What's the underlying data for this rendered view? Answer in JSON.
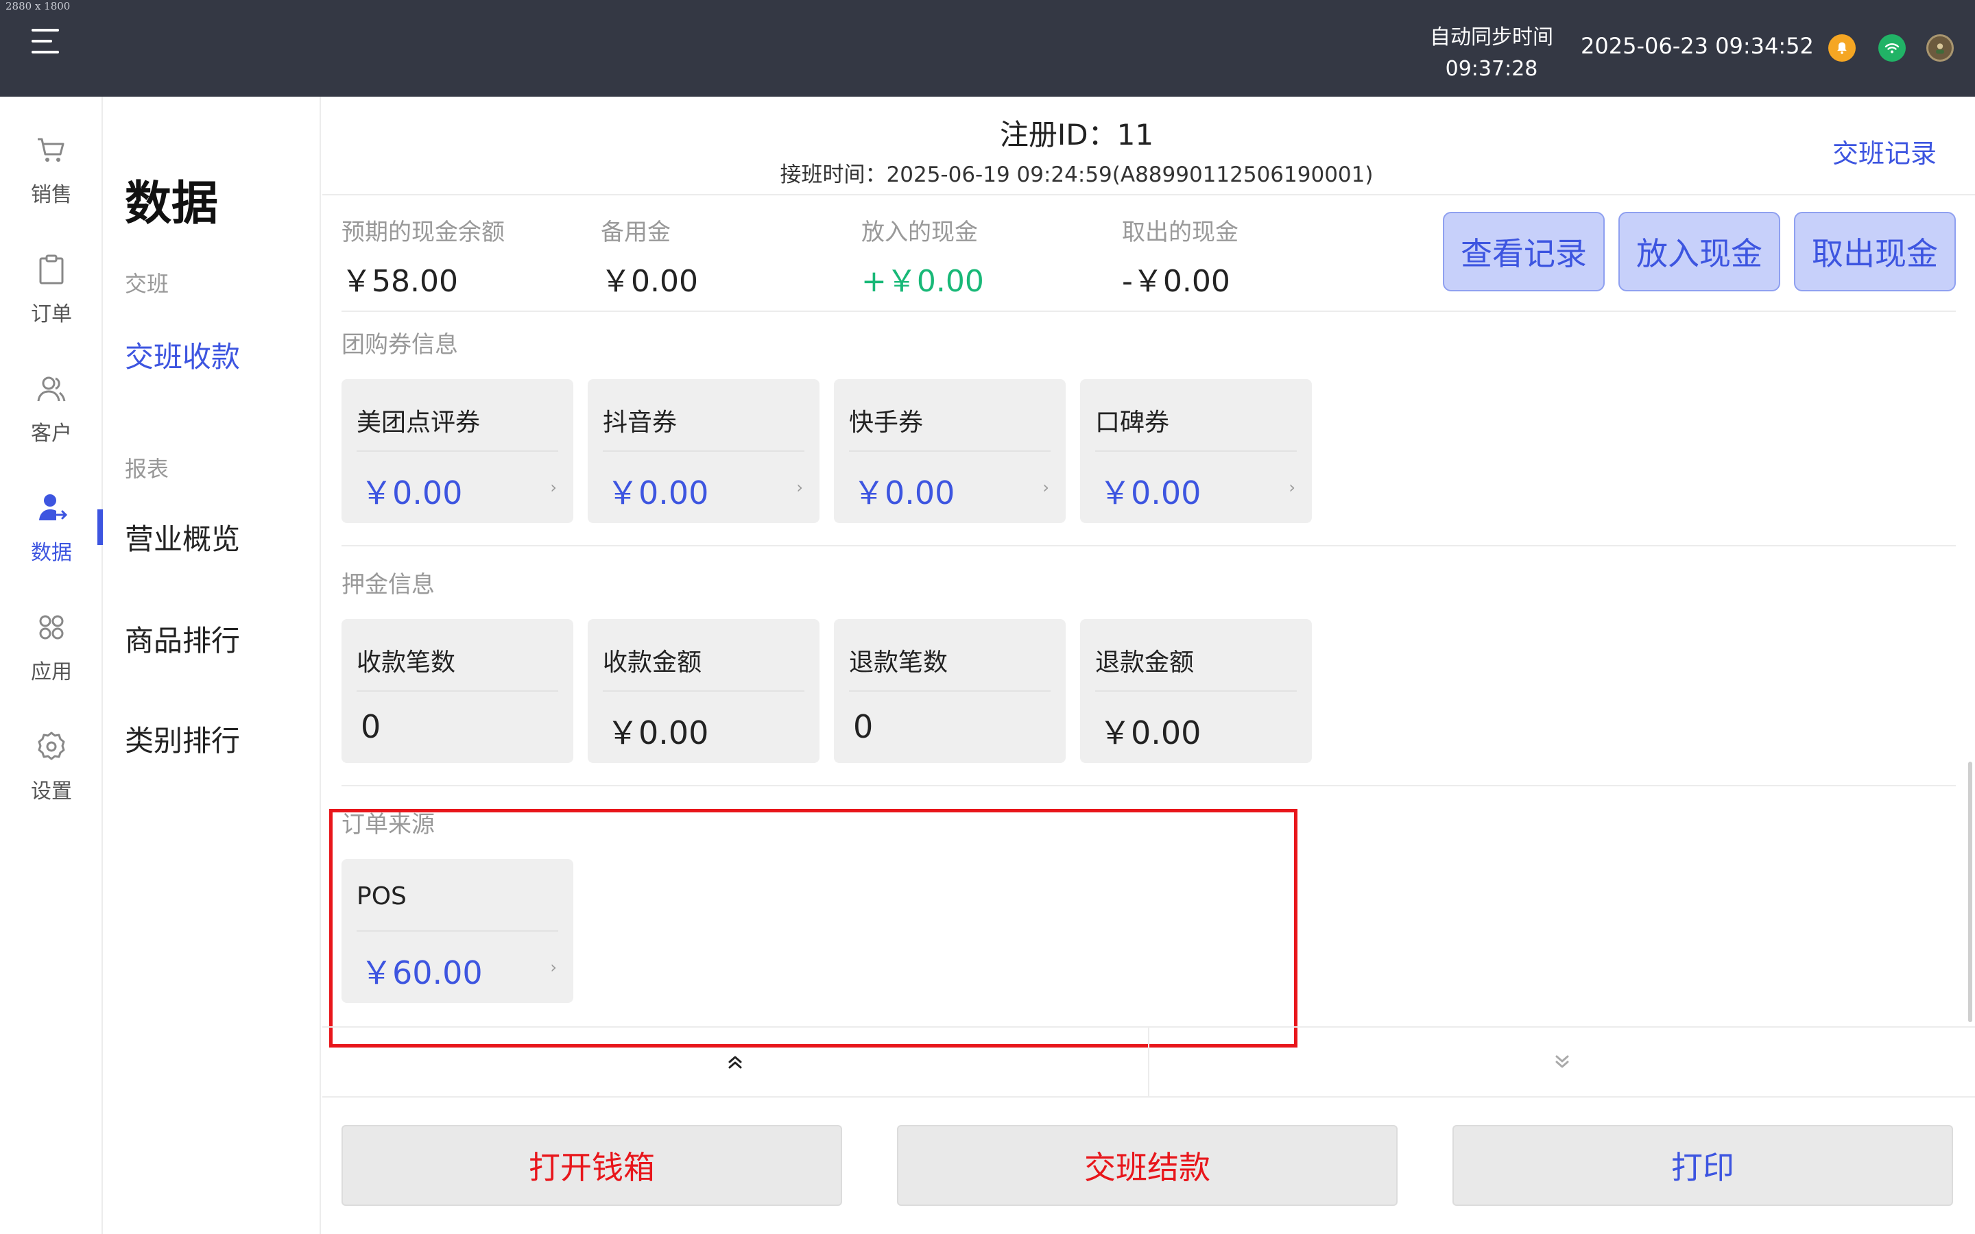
{
  "screen_dims_label": "2880 x 1800",
  "topbar": {
    "sync_label": "自动同步时间",
    "sync_time": "09:37:28",
    "datetime": "2025-06-23 09:34:52"
  },
  "leftnav": {
    "items": [
      {
        "label": "销售",
        "icon": "cart-icon"
      },
      {
        "label": "订单",
        "icon": "clipboard-icon"
      },
      {
        "label": "客户",
        "icon": "users-icon"
      },
      {
        "label": "数据",
        "icon": "user-data-icon",
        "active": true
      },
      {
        "label": "应用",
        "icon": "apps-grid-icon"
      },
      {
        "label": "设置",
        "icon": "gear-icon"
      }
    ]
  },
  "subnav": {
    "title": "数据",
    "section1": "交班",
    "item_handover": "交班收款",
    "section2": "报表",
    "item_overview": "营业概览",
    "item_product_rank": "商品排行",
    "item_category_rank": "类别排行"
  },
  "header": {
    "register_id": "注册ID：11",
    "shift_time": "接班时间：2025-06-19 09:24:59(A88990112506190001)",
    "handover_record": "交班记录"
  },
  "stats": {
    "expected_cash_label": "预期的现金余额",
    "expected_cash_value": "￥58.00",
    "reserve_label": "备用金",
    "reserve_value": "￥0.00",
    "cash_in_label": "放入的现金",
    "cash_in_value": "+￥0.00",
    "cash_out_label": "取出的现金",
    "cash_out_value": "-￥0.00"
  },
  "actions": {
    "view_records": "查看记录",
    "put_cash": "放入现金",
    "take_cash": "取出现金"
  },
  "coupons": {
    "section_label": "团购券信息",
    "cards": [
      {
        "title": "美团点评券",
        "amount": "￥0.00"
      },
      {
        "title": "抖音券",
        "amount": "￥0.00"
      },
      {
        "title": "快手券",
        "amount": "￥0.00"
      },
      {
        "title": "口碑券",
        "amount": "￥0.00"
      }
    ]
  },
  "deposit": {
    "section_label": "押金信息",
    "cards": [
      {
        "title": "收款笔数",
        "amount": "0"
      },
      {
        "title": "收款金额",
        "amount": "￥0.00"
      },
      {
        "title": "退款笔数",
        "amount": "0"
      },
      {
        "title": "退款金额",
        "amount": "￥0.00"
      }
    ]
  },
  "order_source": {
    "section_label": "订单来源",
    "cards": [
      {
        "title": "POS",
        "amount": "￥60.00"
      }
    ]
  },
  "chevron": "›",
  "bottom": {
    "open_drawer": "打开钱箱",
    "settle_shift": "交班结款",
    "print": "打印"
  },
  "colors": {
    "accent": "#3d55e0",
    "danger": "#e8161b",
    "success": "#18b877",
    "topbar": "#343844"
  }
}
